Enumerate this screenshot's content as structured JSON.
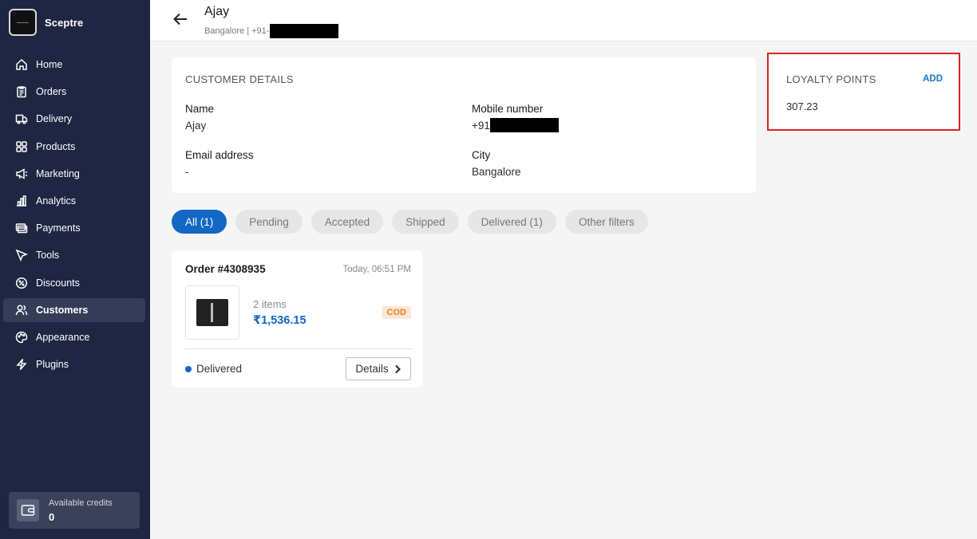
{
  "sidebar": {
    "brand": "Sceptre",
    "items": [
      {
        "label": "Home",
        "icon": "home-icon"
      },
      {
        "label": "Orders",
        "icon": "clipboard-icon"
      },
      {
        "label": "Delivery",
        "icon": "truck-icon"
      },
      {
        "label": "Products",
        "icon": "grid-icon"
      },
      {
        "label": "Marketing",
        "icon": "megaphone-icon"
      },
      {
        "label": "Analytics",
        "icon": "bar-chart-icon"
      },
      {
        "label": "Payments",
        "icon": "card-icon"
      },
      {
        "label": "Tools",
        "icon": "pointer-icon"
      },
      {
        "label": "Discounts",
        "icon": "discount-icon"
      },
      {
        "label": "Customers",
        "icon": "users-icon",
        "active": true
      },
      {
        "label": "Appearance",
        "icon": "palette-icon"
      },
      {
        "label": "Plugins",
        "icon": "lightning-icon"
      }
    ],
    "credits": {
      "label": "Available credits",
      "value": "0"
    }
  },
  "header": {
    "name": "Ajay",
    "subtitle": "Bangalore | +91-"
  },
  "customer_details": {
    "title": "CUSTOMER DETAILS",
    "name_label": "Name",
    "name_value": "Ajay",
    "mobile_label": "Mobile number",
    "mobile_value": "+91",
    "email_label": "Email address",
    "email_value": "-",
    "city_label": "City",
    "city_value": "Bangalore"
  },
  "loyalty": {
    "title": "LOYALTY POINTS",
    "add_label": "ADD",
    "points": "307.23"
  },
  "filters": [
    "All (1)",
    "Pending",
    "Accepted",
    "Shipped",
    "Delivered (1)",
    "Other filters"
  ],
  "order": {
    "id": "Order #4308935",
    "time": "Today, 06:51 PM",
    "items": "2 items",
    "price": "₹1,536.15",
    "payment": "COD",
    "status": "Delivered",
    "details_label": "Details"
  },
  "colors": {
    "sidebar_bg": "#1e2642",
    "accent": "#1268c3",
    "highlight_border": "#e02020"
  }
}
